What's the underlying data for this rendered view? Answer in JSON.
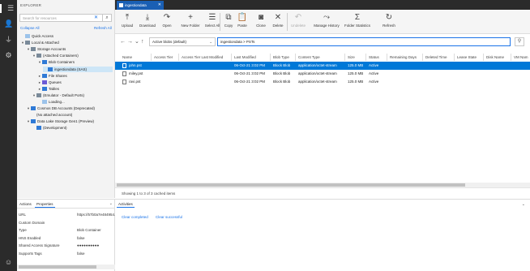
{
  "activity_bar": {
    "icons": [
      "menu-icon",
      "account-icon",
      "plug-icon",
      "gear-icon"
    ]
  },
  "explorer": {
    "title": "EXPLORER",
    "search_placeholder": "Search for resources",
    "collapse_all": "Collapse All",
    "refresh_all": "Refresh All",
    "tree": [
      {
        "label": "Quick Access",
        "depth": 0,
        "twisty": "",
        "icon": "star-icon"
      },
      {
        "label": "Local & Attached",
        "depth": 0,
        "twisty": "▾",
        "icon": "link-icon"
      },
      {
        "label": "Storage Accounts",
        "depth": 1,
        "twisty": "▾",
        "icon": "storage-icon"
      },
      {
        "label": "(Attached Containers)",
        "depth": 2,
        "twisty": "▾",
        "icon": "folder-icon"
      },
      {
        "label": "Blob Containers",
        "depth": 3,
        "twisty": "▾",
        "icon": "blob-icon"
      },
      {
        "label": "ingestiondata (SAS)",
        "depth": 4,
        "twisty": "",
        "icon": "container-icon",
        "selected": true
      },
      {
        "label": "File Shares",
        "depth": 3,
        "twisty": "▸",
        "icon": "fileshare-icon"
      },
      {
        "label": "Queues",
        "depth": 3,
        "twisty": "▸",
        "icon": "queue-icon"
      },
      {
        "label": "Tables",
        "depth": 3,
        "twisty": "▸",
        "icon": "table-icon"
      },
      {
        "label": "(Emulator - Default Ports)",
        "depth": 2,
        "twisty": "▾",
        "icon": "emulator-icon"
      },
      {
        "label": "Loading...",
        "depth": 3,
        "twisty": "",
        "icon": "spinner-icon"
      },
      {
        "label": "Cosmos DB Accounts (Deprecated)",
        "depth": 1,
        "twisty": "▾",
        "icon": "cosmos-icon"
      },
      {
        "label": "(No attached account)",
        "depth": 2,
        "twisty": "",
        "icon": ""
      },
      {
        "label": "Data Lake Storage Gen1 (Preview)",
        "depth": 1,
        "twisty": "▾",
        "icon": "datalake-icon"
      },
      {
        "label": "(Development)",
        "depth": 2,
        "twisty": "",
        "icon": "dev-icon"
      }
    ]
  },
  "properties": {
    "tabs": [
      "Actions",
      "Properties"
    ],
    "active_tab": "Properties",
    "rows": [
      {
        "label": "URL",
        "value": "https://57b0a7e484954..."
      },
      {
        "label": "Custom Domain",
        "value": ""
      },
      {
        "label": "Type",
        "value": "Blob Container"
      },
      {
        "label": "HNS Enabled",
        "value": "false"
      },
      {
        "label": "Shared Access Signature",
        "value": "●●●●●●●●●●"
      },
      {
        "label": "Supports Tags",
        "value": "false"
      }
    ]
  },
  "tab": {
    "label": "ingestiondata"
  },
  "toolbar": {
    "buttons": [
      {
        "label": "Upload",
        "icon": "upload-icon",
        "glyph": "⤒",
        "disabled": false
      },
      {
        "label": "Download",
        "icon": "download-icon",
        "glyph": "⤓",
        "disabled": false
      },
      {
        "label": "Open",
        "icon": "open-icon",
        "glyph": "↷",
        "disabled": false
      },
      {
        "label": "New Folder",
        "icon": "new-folder-icon",
        "glyph": "+",
        "disabled": false
      },
      {
        "label": "Select All",
        "icon": "select-all-icon",
        "glyph": "☰",
        "disabled": false
      },
      {
        "label": "Copy",
        "icon": "copy-icon",
        "glyph": "⧉",
        "disabled": false
      },
      {
        "label": "Paste",
        "icon": "paste-icon",
        "glyph": "📋",
        "disabled": false
      },
      {
        "label": "Clone",
        "icon": "clone-icon",
        "glyph": "◙",
        "disabled": false
      },
      {
        "label": "Delete",
        "icon": "delete-icon",
        "glyph": "✕",
        "disabled": false
      },
      {
        "label": "Undelete",
        "icon": "undelete-icon",
        "glyph": "↶",
        "disabled": true
      },
      {
        "label": "Manage History",
        "icon": "history-icon",
        "glyph": "⤳",
        "disabled": false
      },
      {
        "label": "Folder Statistics",
        "icon": "statistics-icon",
        "glyph": "Σ",
        "disabled": false
      },
      {
        "label": "Refresh",
        "icon": "refresh-icon",
        "glyph": "↻",
        "disabled": false
      }
    ]
  },
  "navigation": {
    "view": "Active blobs (default)",
    "path": "ingestiondata  >  PSTs"
  },
  "table": {
    "columns": [
      "Name",
      "Access Tier",
      "Access Tier Last Modified",
      "Last Modified",
      "Blob Type",
      "Content Type",
      "Size",
      "Status",
      "Remaining Days",
      "Deleted Time",
      "Lease State",
      "Disk Name",
      "VM Nam"
    ],
    "rows": [
      {
        "name": "john.pst",
        "access_tier": "",
        "tier_modified": "",
        "last_modified": "06-Oct-21 3:02 PM",
        "blob_type": "Block Blob",
        "content_type": "application/octet-stream",
        "size": "125.0 MB",
        "status": "Active",
        "selected": true
      },
      {
        "name": "miley.pst",
        "access_tier": "",
        "tier_modified": "",
        "last_modified": "06-Oct-21 3:02 PM",
        "blob_type": "Block Blob",
        "content_type": "application/octet-stream",
        "size": "125.0 MB",
        "status": "Active",
        "selected": false
      },
      {
        "name": "ravi.pst",
        "access_tier": "",
        "tier_modified": "",
        "last_modified": "06-Oct-21 3:02 PM",
        "blob_type": "Block Blob",
        "content_type": "application/octet-stream",
        "size": "125.0 MB",
        "status": "Active",
        "selected": false
      }
    ],
    "status": "Showing 1 to 3 of 3 cached items"
  },
  "activities": {
    "tab": "Activities",
    "clear_completed": "Clear completed",
    "clear_successful": "Clear successful"
  },
  "colors": {
    "accent": "#0078d7",
    "tab": "#1a5fb4",
    "dark": "#2b2b2b"
  }
}
